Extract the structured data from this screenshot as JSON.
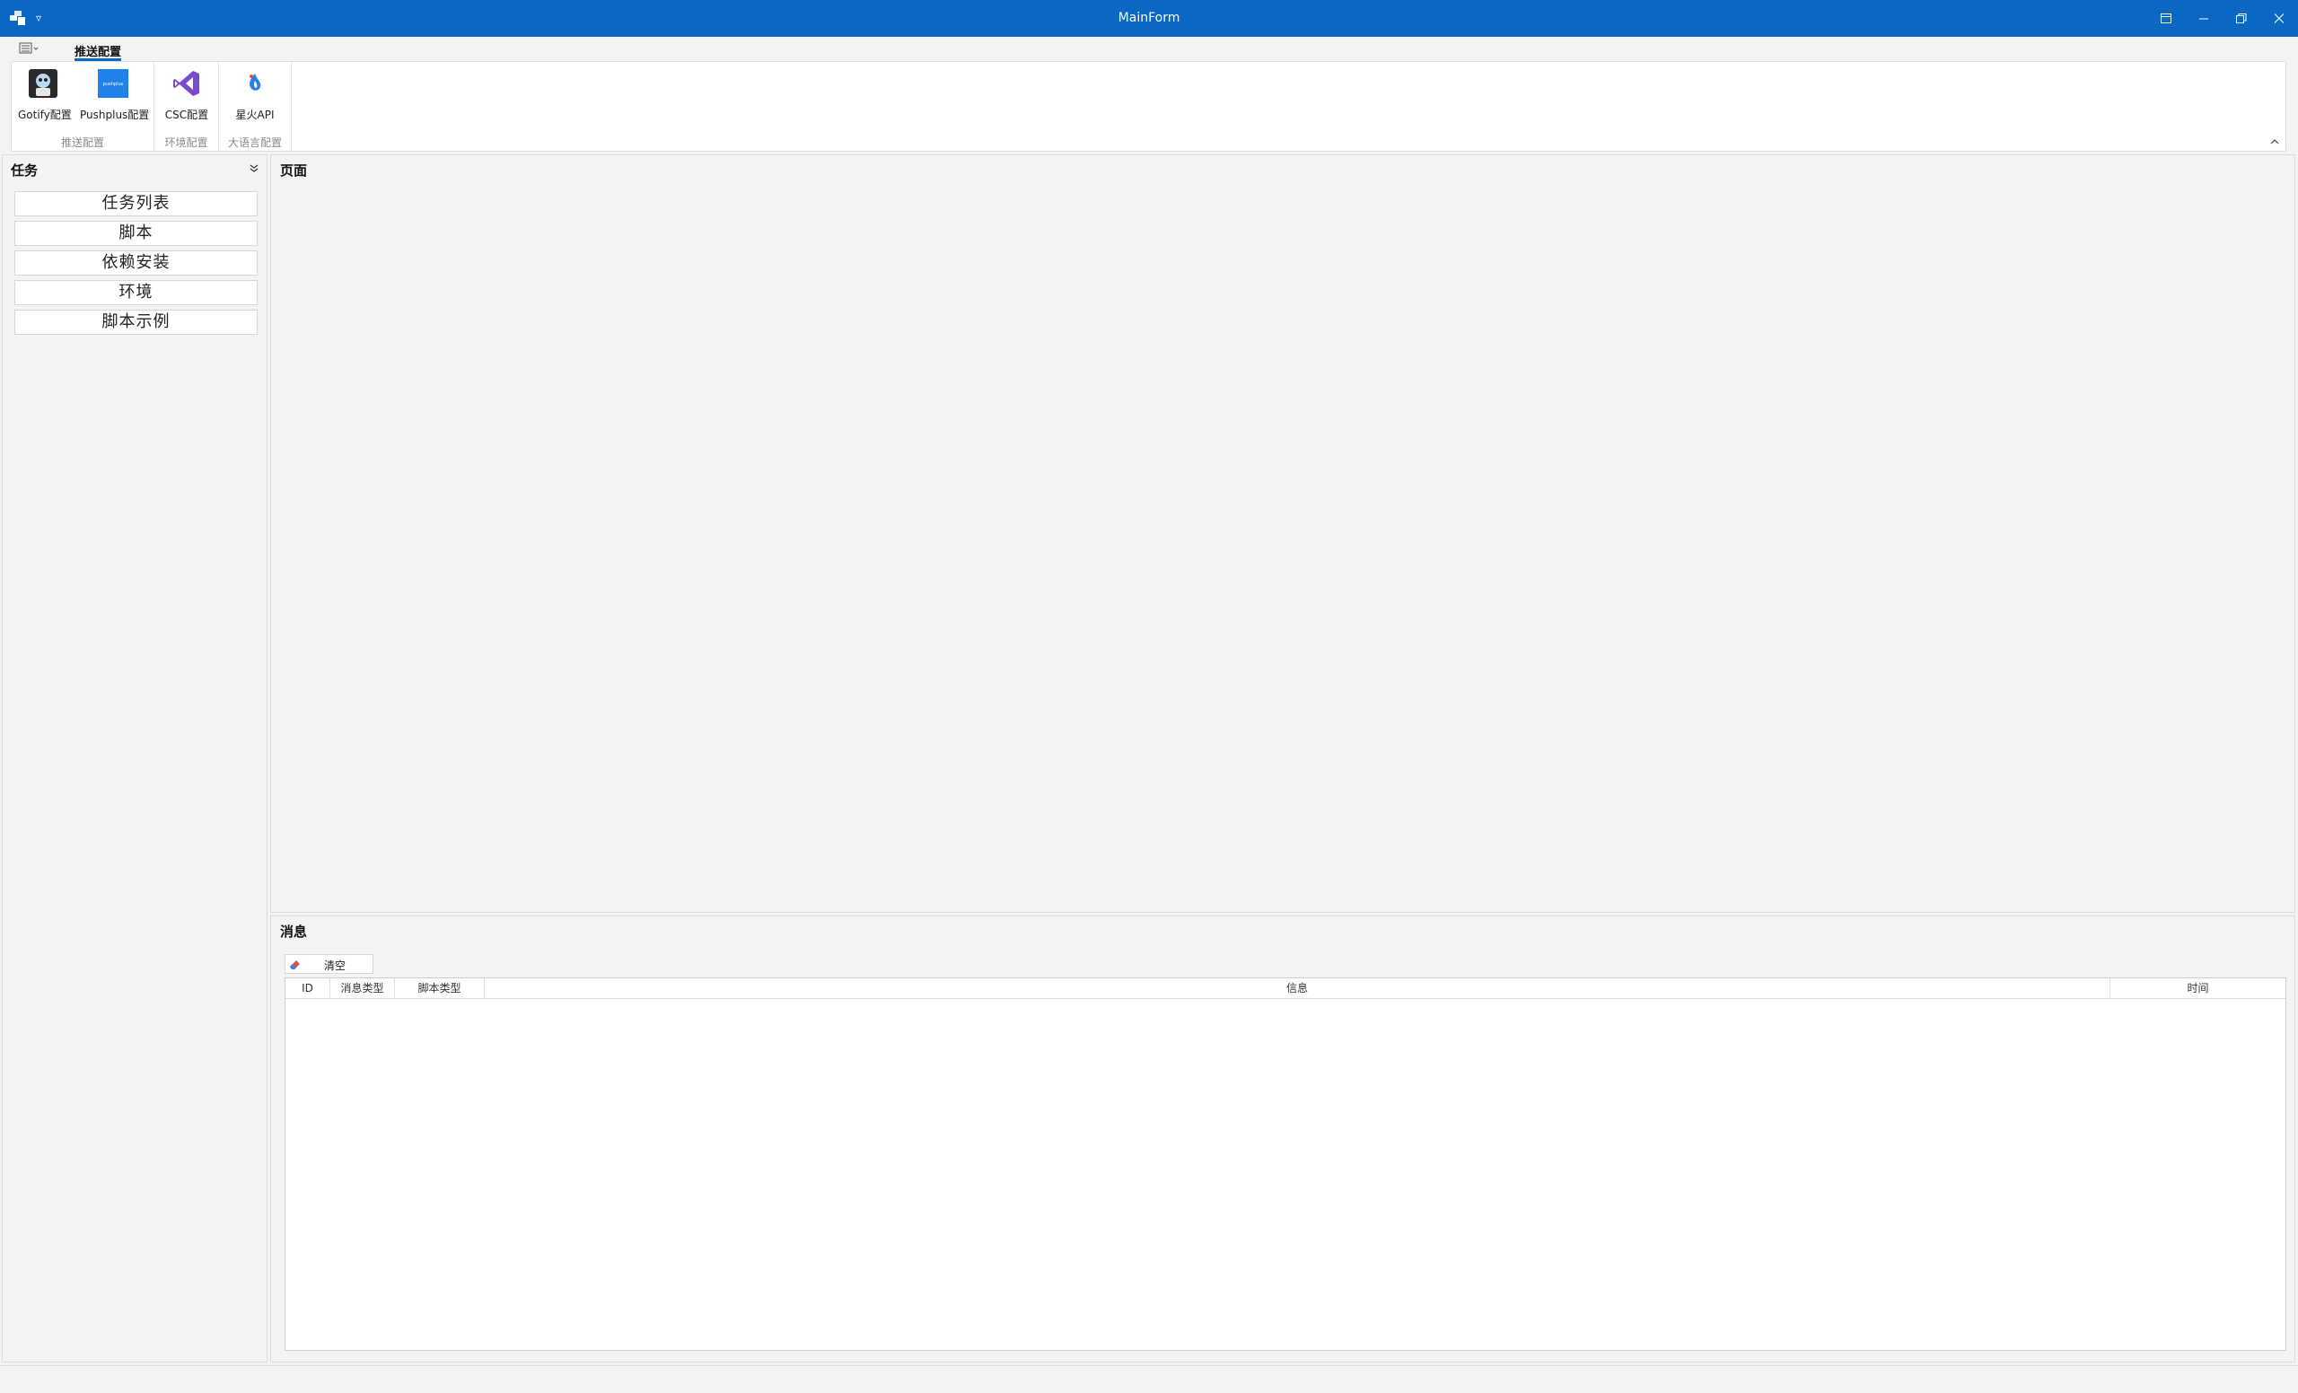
{
  "window": {
    "title": "MainForm"
  },
  "ribbon": {
    "tab": "推送配置",
    "groups": [
      {
        "caption": "推送配置",
        "buttons": [
          "Gotify配置",
          "Pushplus配置"
        ]
      },
      {
        "caption": "环境配置",
        "buttons": [
          "CSC配置"
        ]
      },
      {
        "caption": "大语言配置",
        "buttons": [
          "星火API"
        ]
      }
    ],
    "pushplus_logo_text": "pushplus"
  },
  "left_panel": {
    "caption": "任务",
    "items": [
      "任务列表",
      "脚本",
      "依赖安装",
      "环境",
      "脚本示例"
    ]
  },
  "page_panel": {
    "caption": "页面"
  },
  "message_panel": {
    "caption": "消息",
    "clear_label": "清空",
    "columns": [
      "ID",
      "消息类型",
      "脚本类型",
      "信息",
      "时间"
    ],
    "rows": []
  },
  "colors": {
    "accent": "#0a67c3",
    "background": "#f3f3f3"
  },
  "icons": [
    "app-icon",
    "gotify-icon",
    "pushplus-icon",
    "visual-studio-icon",
    "spark-icon",
    "eraser-icon"
  ]
}
